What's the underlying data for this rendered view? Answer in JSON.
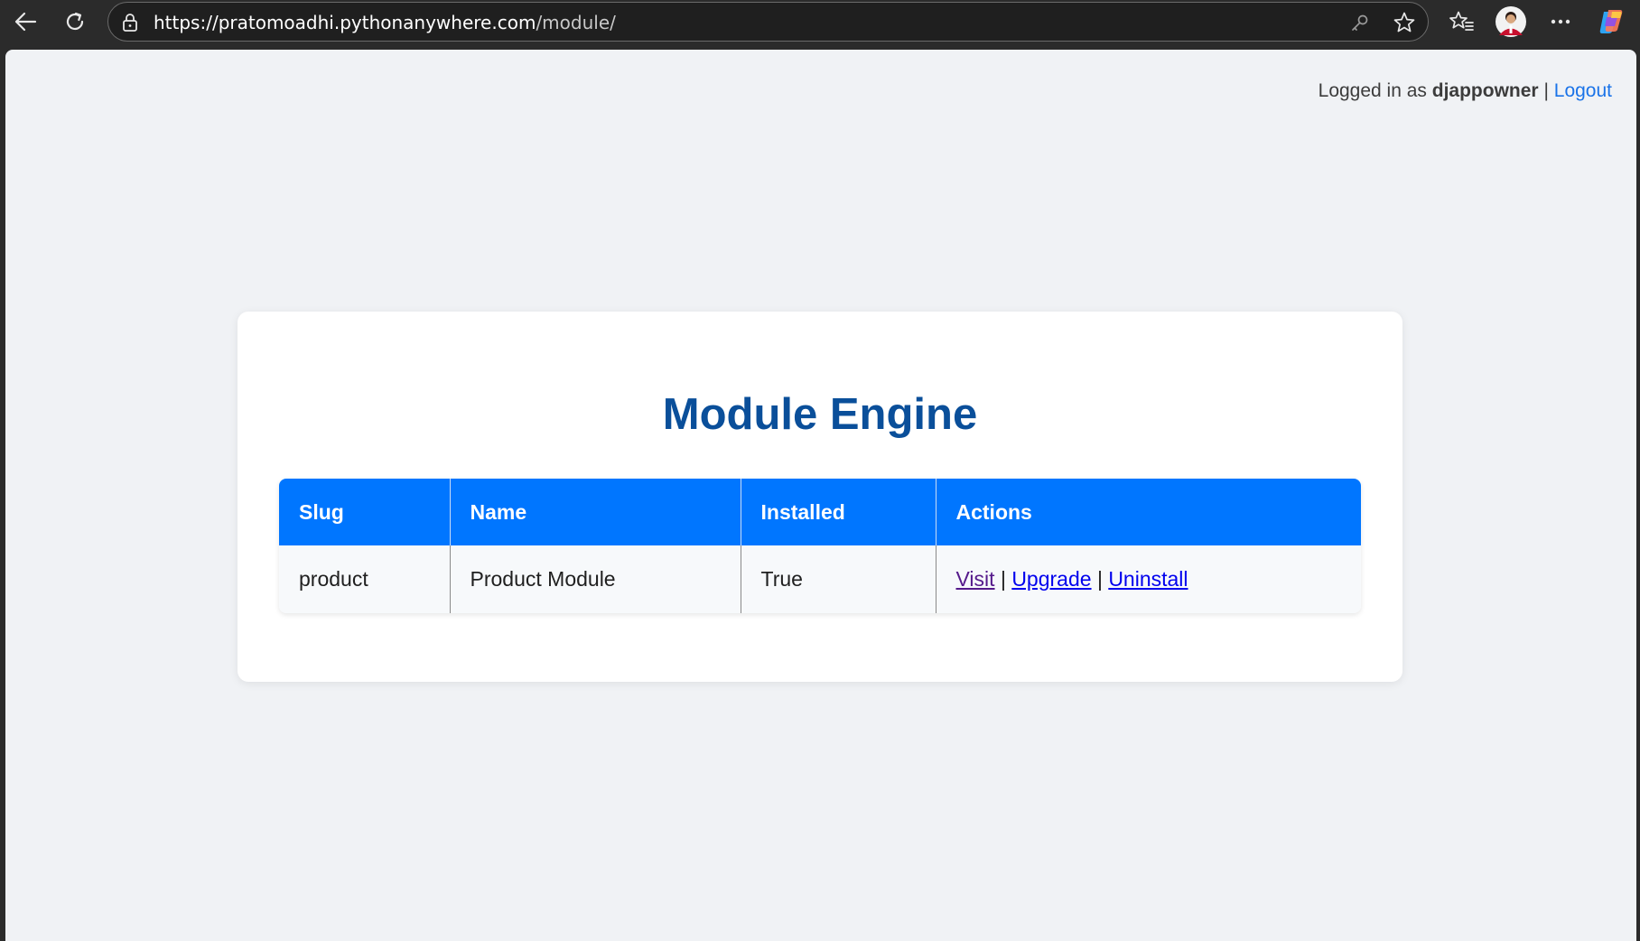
{
  "browser": {
    "url_host": "https://pratomoadhi.pythonanywhere.com",
    "url_path": "/module/",
    "icons": [
      "back-arrow-icon",
      "reload-icon",
      "lock-icon",
      "key-icon",
      "star-icon",
      "favorites-icon",
      "profile-avatar",
      "more-icon",
      "copilot-icon"
    ]
  },
  "header": {
    "logged_in_prefix": "Logged in as",
    "username": "djappowner",
    "separator": "|",
    "logout_label": "Logout"
  },
  "main": {
    "title": "Module Engine",
    "table": {
      "columns": [
        "Slug",
        "Name",
        "Installed",
        "Actions"
      ],
      "rows": [
        {
          "slug": "product",
          "name": "Product Module",
          "installed": "True",
          "actions": {
            "visit": "Visit",
            "sep1": "|",
            "upgrade": "Upgrade",
            "sep2": "|",
            "uninstall": "Uninstall"
          }
        }
      ]
    }
  },
  "colors": {
    "accent": "#0076ff",
    "title": "#0a4f9a",
    "link": "#0000ee",
    "visited_link": "#551a8b",
    "page_bg": "#f0f2f5"
  }
}
